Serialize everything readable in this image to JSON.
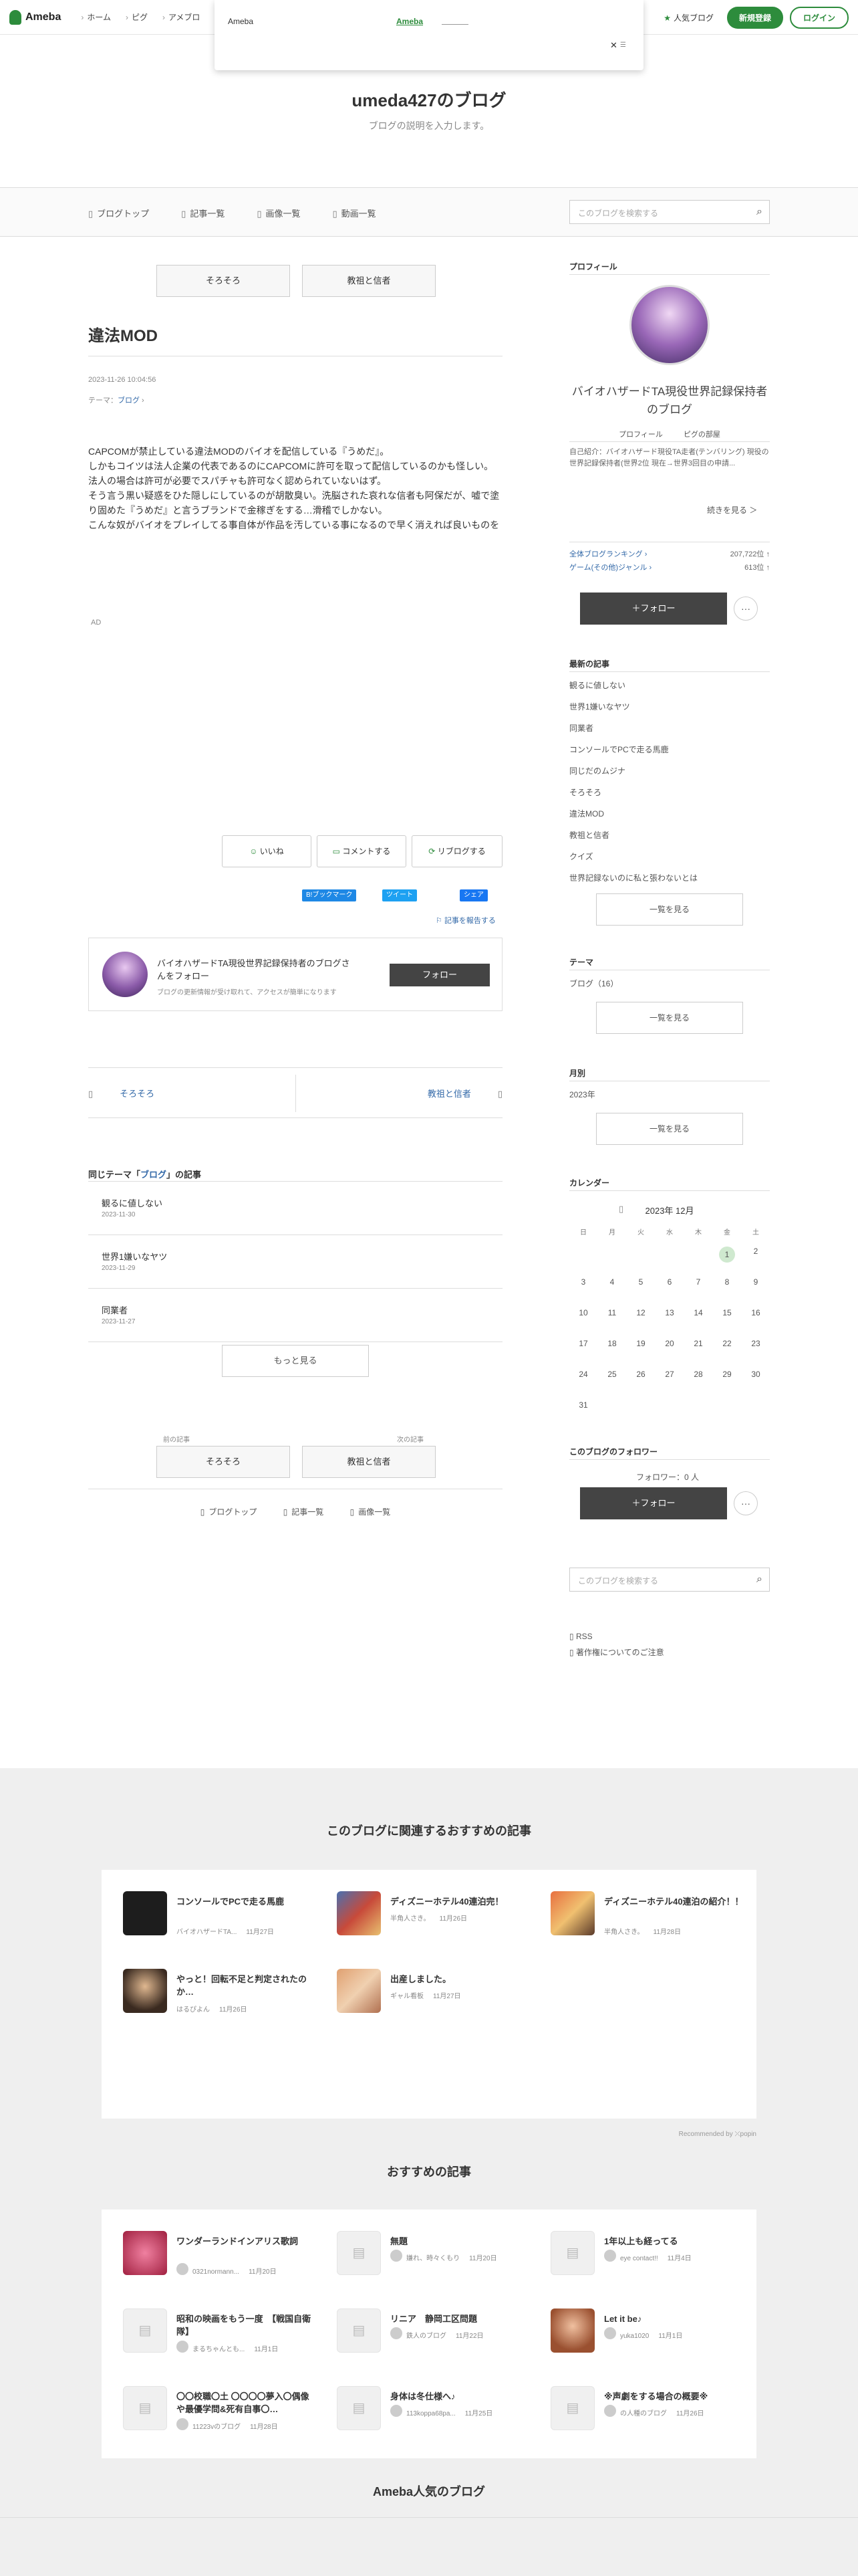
{
  "topbar": {
    "logo": "Ameba",
    "nav": [
      "ホーム",
      "ピグ",
      "アメブロ"
    ],
    "popular": "人気ブログ",
    "signup": "新規登録",
    "login": "ログイン"
  },
  "popup": {
    "left_text": "Ameba",
    "link_text": "Ameba",
    "close": "✕"
  },
  "blog": {
    "title": "umeda427のブログ",
    "description": "ブログの説明を入力します。"
  },
  "gnav": {
    "items": [
      "ブログトップ",
      "記事一覧",
      "画像一覧",
      "動画一覧"
    ],
    "search_placeholder": "このブログを検索する"
  },
  "article": {
    "prev_label": "そろそろ",
    "next_label": "教祖と信者",
    "title": "違法MOD",
    "date": "2023-11-26 10:04:56",
    "theme_prefix": "テーマ：",
    "theme": "ブログ",
    "body": [
      "CAPCOMが禁止している違法MODのバイオを配信している『うめだ』。",
      "しかもコイツは法人企業の代表であるのにCAPCOMに許可を取って配信しているのかも怪しい。",
      "法人の場合は許可が必要でスパチャも許可なく認められていないはず。",
      "そう言う黒い疑惑をひた隠しにしているのが胡散臭い。洗脳された哀れな信者も阿保だが、嘘で塗り固めた『うめだ』と言うブランドで金稼ぎをする…滑稽でしかない。",
      "こんな奴がバイオをプレイしてる事自体が作品を汚している事になるので早く消えれば良いものを"
    ],
    "ad": "AD",
    "like": "いいね",
    "comment": "コメントする",
    "reblog": "リブログする",
    "share_hatena": "B!ブックマーク",
    "share_tw": "ツイート",
    "share_fb": "シェア",
    "report": "記事を報告する",
    "follow_title": "バイオハザードTA現役世界記録保持者のブログさんをフォロー",
    "follow_sub": "ブログの更新情報が受け取れて、アクセスが簡単になります",
    "follow_btn": "フォロー",
    "pager_prev": "そろそろ",
    "pager_next": "教祖と信者",
    "same_theme_prefix": "同じテーマ「",
    "same_theme_name": "ブログ",
    "same_theme_suffix": "」の記事",
    "related": [
      {
        "t": "観るに値しない",
        "d": "2023-11-30"
      },
      {
        "t": "世界1嫌いなヤツ",
        "d": "2023-11-29"
      },
      {
        "t": "同業者",
        "d": "2023-11-27"
      }
    ],
    "more": "もっと見る",
    "prev_small": "前の記事",
    "next_small": "次の記事",
    "bottom_nav": [
      "ブログトップ",
      "記事一覧",
      "画像一覧"
    ]
  },
  "side": {
    "profile_h": "プロフィール",
    "name": "バイオハザードTA現役世界記録保持者のブログ",
    "links": [
      "プロフィール",
      "ピグの部屋"
    ],
    "desc": "自己紹介：バイオハザード現役TA走者(テンバリング) 現役の世界記録保持者(世界2位 現在→世界3回目の申請...",
    "read_more": "続きを見る ＞",
    "ranks": [
      {
        "k": "全体ブログランキング",
        "v": "207,722位 ↑"
      },
      {
        "k": "ゲーム(その他)ジャンル",
        "v": "613位 ↑"
      }
    ],
    "follow": "＋フォロー",
    "dots": "···",
    "latest_h": "最新の記事",
    "latest": [
      "観るに値しない",
      "世界1嫌いなヤツ",
      "同業者",
      "コンソールでPCで走る馬鹿",
      "同じだのムジナ",
      "そろそろ",
      "違法MOD",
      "教祖と信者",
      "クイズ",
      "世界記録ないのに私と張わないとは"
    ],
    "list_btn": "一覧を見る",
    "theme_h": "テーマ",
    "theme_item": "ブログ（16）",
    "month_h": "月別",
    "month_item": "2023年",
    "cal_h": "カレンダー",
    "cal_title": "2023年 12月",
    "weekdays": [
      "日",
      "月",
      "火",
      "水",
      "木",
      "金",
      "土"
    ],
    "followers_h": "このブログのフォロワー",
    "followers": "フォロワー：0 人",
    "search_placeholder": "このブログを検索する",
    "rss": "RSS",
    "copyright": "著作権についてのご注意"
  },
  "reco1": {
    "heading": "このブログに関連するおすすめの記事",
    "items": [
      {
        "t": "コンソールでPCで走る馬鹿",
        "a": "バイオハザードTA...",
        "d": "11月27日"
      },
      {
        "t": "ディズニーホテル40連泊完！",
        "a": "半角人さき。",
        "d": "11月26日"
      },
      {
        "t": "ディズニーホテル40連泊の紹介！！",
        "a": "半角人さき。",
        "d": "11月28日"
      },
      {
        "t": "やっと！回転不足と判定されたのか…",
        "a": "はるぴよん",
        "d": "11月26日"
      },
      {
        "t": "出産しました。",
        "a": "ギャル看板",
        "d": "11月27日"
      }
    ],
    "recommended_by": "Recommended by ⤫popin"
  },
  "reco2": {
    "heading": "おすすめの記事",
    "items": [
      {
        "t": "ワンダーランドインアリス歌詞",
        "a": "0321normann...",
        "d": "11月20日"
      },
      {
        "t": "無題",
        "a": "嫌れ、時々くもり",
        "d": "11月20日"
      },
      {
        "t": "1年以上も経ってる",
        "a": "eye contact!!",
        "d": "11月4日"
      },
      {
        "t": "昭和の映画をもう一度　【戦国自衛隊】",
        "a": "まるちゃんとも...",
        "d": "11月1日"
      },
      {
        "t": "リニア　静岡工区問題",
        "a": "鉄人のブログ",
        "d": "11月22日"
      },
      {
        "t": "Let it be♪",
        "a": "yuka1020",
        "d": "11月1日"
      },
      {
        "t": "〇〇校職〇土 〇〇〇〇夢入〇偶像や最優学問&死有自事〇…",
        "a": "11223vのブログ",
        "d": "11月28日"
      },
      {
        "t": "身体は冬仕様へ♪",
        "a": "113koppa68pa...",
        "d": "11月25日"
      },
      {
        "t": "※声劇をする場合の概要※",
        "a": "の人種のブログ",
        "d": "11月26日"
      }
    ]
  },
  "reco3": {
    "heading": "Ameba人気のブログ"
  },
  "colors": {
    "brand": "#2d8c3c",
    "link": "#3369a8"
  }
}
